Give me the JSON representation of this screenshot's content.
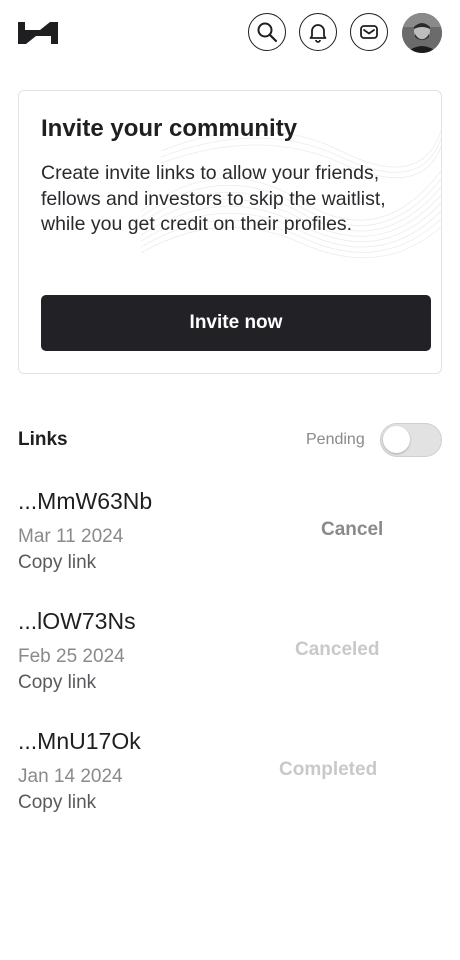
{
  "header": {
    "logo": "logo-icon",
    "icons": [
      "search-icon",
      "bell-icon",
      "mail-icon"
    ],
    "avatar": "user-avatar"
  },
  "invite_card": {
    "title": "Invite your community",
    "body": "Create invite links to allow your friends, fellows and investors to skip the waitlist, while you get credit on their profiles.",
    "button_label": "Invite now"
  },
  "links": {
    "label": "Links",
    "filter_label": "Pending",
    "filter_on": false,
    "items": [
      {
        "code": "...MmW63Nb",
        "date": "Mar 11 2024",
        "copy_label": "Copy link",
        "status": "Cancel",
        "status_color": "#8a8a8a"
      },
      {
        "code": "...lOW73Ns",
        "date": "Feb 25 2024",
        "copy_label": "Copy link",
        "status": "Canceled",
        "status_color": "#c9c9c9"
      },
      {
        "code": "...MnU17Ok",
        "date": "Jan 14 2024",
        "copy_label": "Copy link",
        "status": "Completed",
        "status_color": "#c9c9c9"
      }
    ]
  },
  "colors": {
    "primary": "#222226",
    "muted": "#8a8a8a",
    "disabled": "#c9c9c9"
  }
}
